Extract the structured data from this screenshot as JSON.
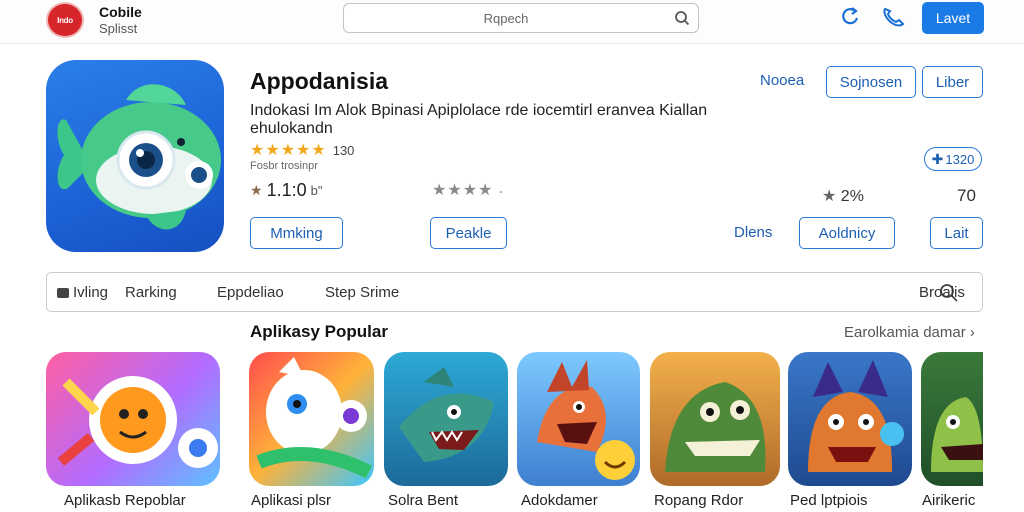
{
  "header": {
    "logo_text": "Indo",
    "brand_name": "Cobile",
    "brand_sub": "Splisst",
    "search_placeholder": "Rqpech",
    "login_label": "Lavet"
  },
  "app": {
    "title": "Appodanisia",
    "description": "Indokasi Im Alok Bpinasi Apiplolace rde iocemtirl eranvea Kiallan ehulokandn",
    "stars": "★★★★★",
    "rating_count": "130",
    "small_note": "Fosbr trosinpr",
    "price": "1.1:0",
    "price_suffix": "b\"",
    "grey_stars": "★★★★",
    "grey_suffix": "-",
    "stat_percent": "2%",
    "stat_num": "70",
    "likes": "1320",
    "buttons": {
      "nooea": "Nooea",
      "sojnosen": "Sojnosen",
      "liber": "Liber",
      "marking": "Mmking",
      "peakle": "Peakle",
      "dlens": "Dlens",
      "aoldnicy": "Aoldnicy",
      "lait": "Lait"
    }
  },
  "tabs": {
    "items": [
      "Ivling",
      "Rarking",
      "Eppdeliao",
      "Step Srime"
    ],
    "search_label": "Broalis"
  },
  "popular": {
    "title": "Aplikasy Popular",
    "see_all": "Earolkamia damar",
    "apps": [
      {
        "label": "Aplikasb Repoblar"
      },
      {
        "label": "Aplikasi plsr"
      },
      {
        "label": "Solra Bent"
      },
      {
        "label": "Adokdamer"
      },
      {
        "label": "Ropang Rdor"
      },
      {
        "label": "Ped lptpiois"
      },
      {
        "label": "Airikeric"
      }
    ]
  },
  "colors": {
    "accent": "#1a7ae6",
    "outline": "#2a7ad6",
    "logo_red": "#d7262b",
    "star_gold": "#f2a81d"
  }
}
